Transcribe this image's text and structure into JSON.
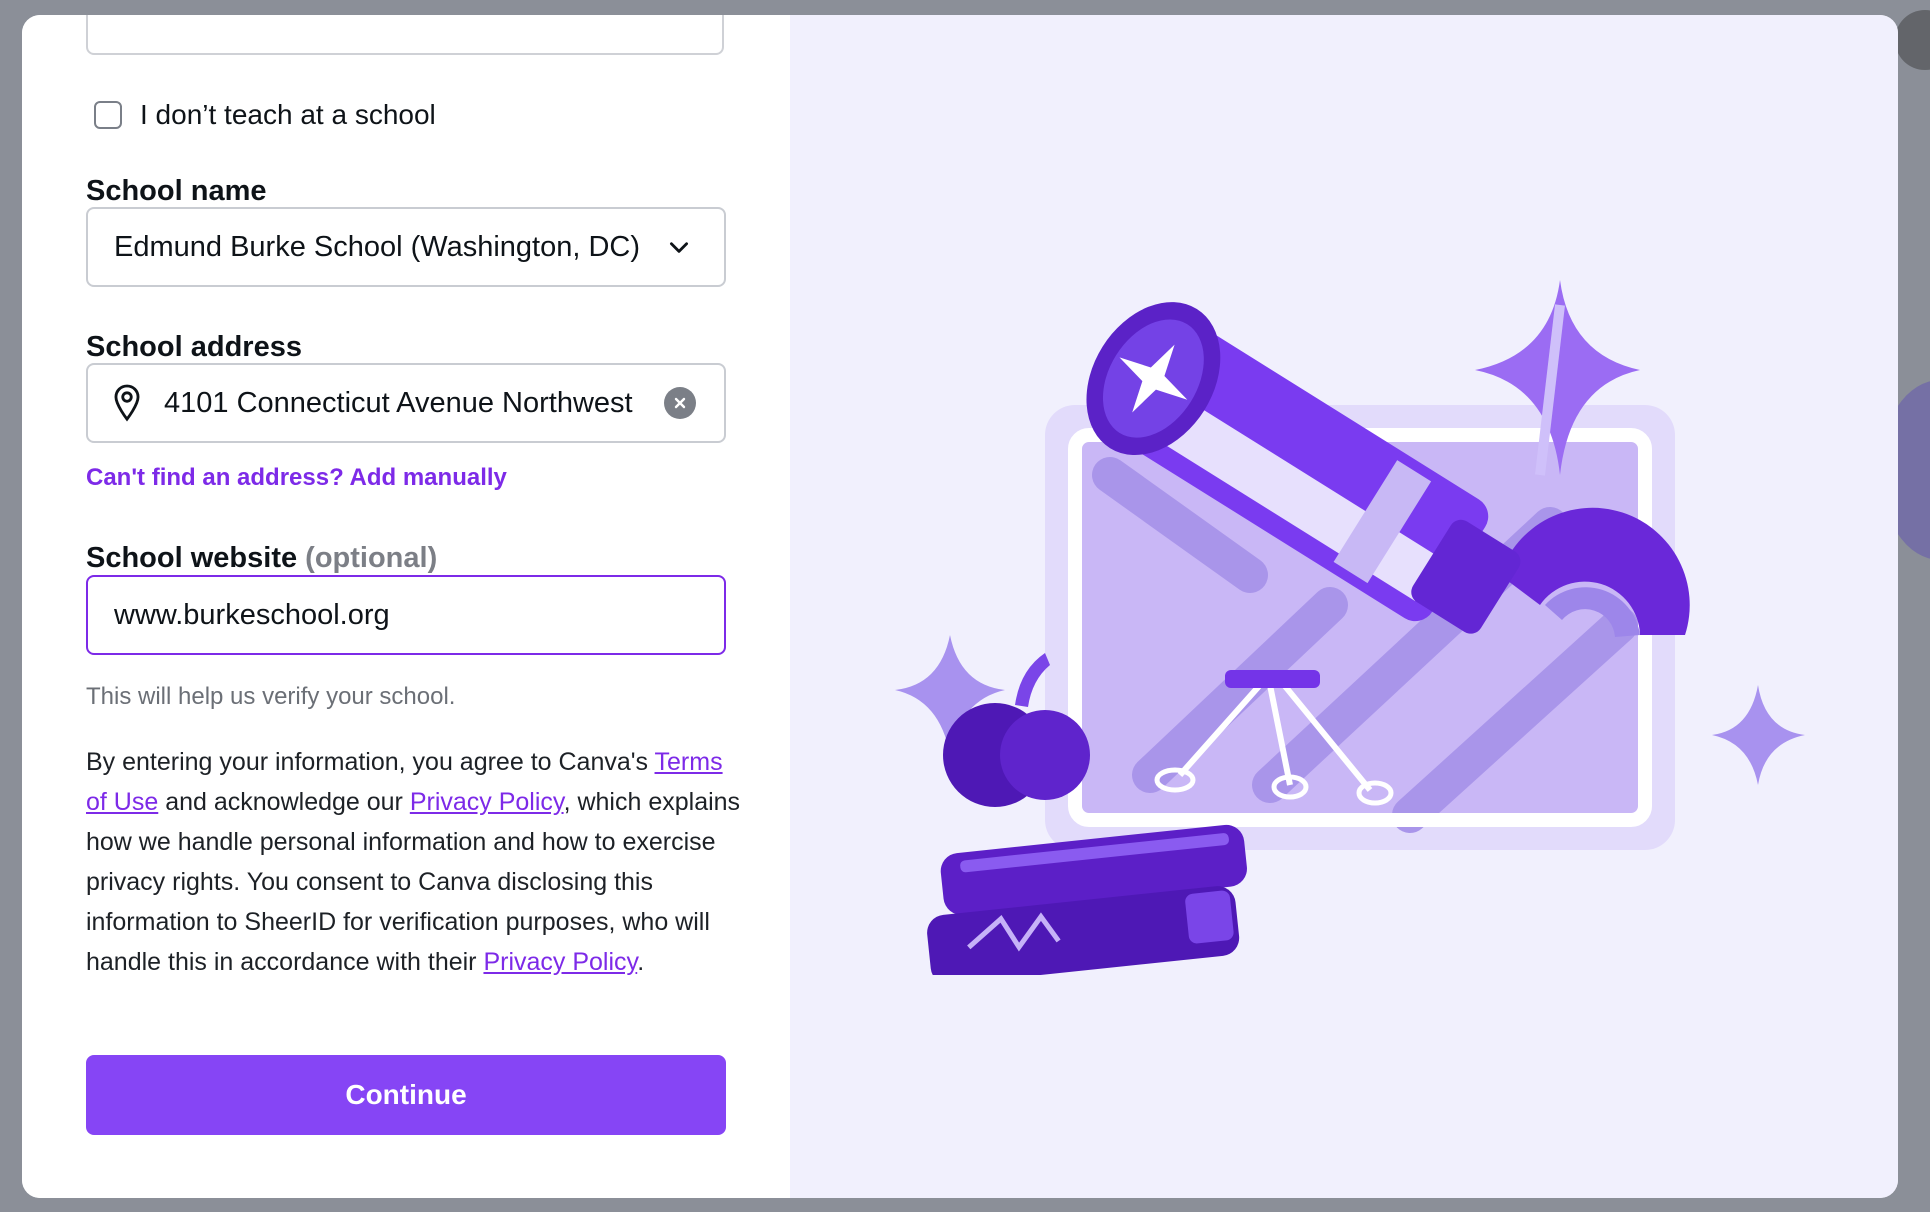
{
  "form": {
    "no_school_checkbox": {
      "label": "I don’t teach at a school",
      "checked": false
    },
    "school_name": {
      "label": "School name",
      "value": "Edmund Burke School (Washington, DC)"
    },
    "school_address": {
      "label": "School address",
      "value": "4101 Connecticut Avenue Northwest"
    },
    "add_manually_link": "Can't find an address? Add manually",
    "school_website": {
      "label": "School website",
      "optional": "(optional)",
      "value": "www.burkeschool.org",
      "hint": "This will help us verify your school."
    },
    "legal": {
      "part1": "By entering your information, you agree to Canva's ",
      "terms_link": "Terms of Use",
      "part2": " and acknowledge our ",
      "privacy_link_1": "Privacy Policy",
      "part3": ", which explains how we handle personal information and how to exercise privacy rights. You consent to Canva disclosing this information to SheerID for verification purposes, who will handle this in accordance with their ",
      "privacy_link_2": "Privacy Policy",
      "part4": "."
    },
    "continue_label": "Continue"
  },
  "icons": {
    "chevron": "chevron-down-icon",
    "location": "location-pin-icon",
    "clear": "clear-icon"
  },
  "colors": {
    "accent": "#7d2ae8",
    "button": "#8645f5",
    "illustration_panel": "#f1f0fd"
  }
}
